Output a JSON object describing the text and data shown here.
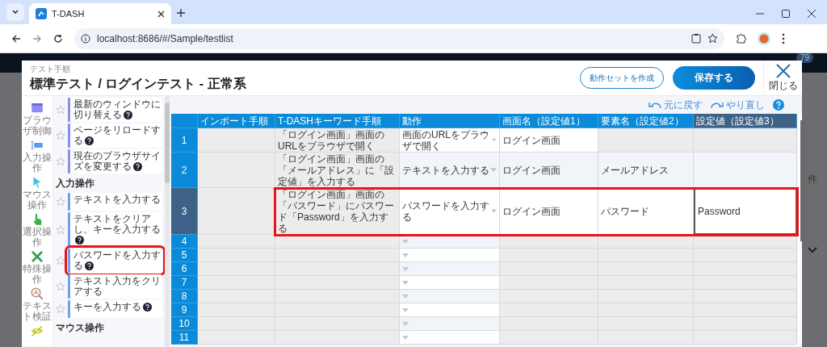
{
  "browser": {
    "tab_title": "T-DASH",
    "url": "localhost:8686/#/Sample/testlist"
  },
  "background_page": {
    "badge": "79",
    "text_fragment": "件"
  },
  "modal": {
    "breadcrumb": "テスト手順",
    "title": "標準テスト / ログインテスト - 正常系",
    "close_label": "閉じる",
    "buttons": [
      {
        "label": "動作セットを作成",
        "kind": "outline"
      },
      {
        "label": "保存する",
        "kind": "primary"
      }
    ]
  },
  "categories": [
    {
      "kind": "browser",
      "label": "ブラウザ制御"
    },
    {
      "kind": "input",
      "label": "入力操作"
    },
    {
      "kind": "mouse",
      "label": "マウス操作"
    },
    {
      "kind": "select",
      "label": "選択操作"
    },
    {
      "kind": "special",
      "label": "特殊操作"
    },
    {
      "kind": "verify",
      "label": "テキスト検証"
    },
    {
      "kind": "hide"
    }
  ],
  "actions": [
    {
      "kind": "item",
      "label": "最新のウィンドウに切り替える",
      "help": true,
      "starred": false,
      "color": "#8c8cf2",
      "highlighted": false
    },
    {
      "kind": "item",
      "label": "ページをリロードする",
      "help": true,
      "starred": false,
      "color": "#8c8cf2",
      "highlighted": false
    },
    {
      "kind": "item",
      "label": "現在のブラウザサイズを変更する",
      "help": true,
      "starred": false,
      "color": "#8c8cf2",
      "highlighted": false
    },
    {
      "kind": "heading",
      "label": "入力操作"
    },
    {
      "kind": "item",
      "label": "テキストを入力する",
      "help": false,
      "starred": false,
      "color": "#6f9ff0",
      "highlighted": false
    },
    {
      "kind": "item",
      "label": "テキストをクリアし、キーを入力する",
      "help": true,
      "starred": false,
      "color": "#6f9ff0",
      "highlighted": false
    },
    {
      "kind": "item",
      "label": "パスワードを入力する",
      "help": true,
      "starred": false,
      "color": "#6f9ff0",
      "highlighted": true
    },
    {
      "kind": "item",
      "label": "テキスト入力をクリアする",
      "help": false,
      "starred": false,
      "color": "#6f9ff0",
      "highlighted": false
    },
    {
      "kind": "item",
      "label": "キーを入力する",
      "help": true,
      "starred": false,
      "color": "#6f9ff0",
      "highlighted": false
    },
    {
      "kind": "heading",
      "label": "マウス操作"
    }
  ],
  "toolbar": {
    "undo": "元に戻す",
    "redo": "やり直し"
  },
  "grid": {
    "columns": [
      {
        "label": "インポート手順",
        "selected": false
      },
      {
        "label": "T-DASHキーワード手順",
        "selected": false
      },
      {
        "label": "動作",
        "selected": false
      },
      {
        "label": "画面名（設定値1）",
        "selected": false
      },
      {
        "label": "要素名（設定値2）",
        "selected": false
      },
      {
        "label": "設定値（設定値3）",
        "selected": true
      }
    ],
    "rows": [
      {
        "number": "1",
        "selected": false,
        "highlighted": false,
        "keyword": "「ログイン画面」画面のURLをブラウザで開く",
        "action": "画面のURLをブラウザで開く",
        "screen": "ログイン画面"
      },
      {
        "number": "2",
        "selected": false,
        "highlighted": false,
        "keyword": "「ログイン画面」画面の「メールアドレス」に「設定値」を入力する",
        "action": "テキストを入力する",
        "screen": "ログイン画面",
        "element": "メールアドレス"
      },
      {
        "number": "3",
        "selected": true,
        "highlighted": true,
        "keyword": "「ログイン画面」画面の「パスワード」にパスワード「Password」を入力する",
        "action": "パスワードを入力する",
        "screen": "ログイン画面",
        "element": "パスワード",
        "value": "Password"
      },
      {
        "number": "4",
        "selected": false,
        "highlighted": false
      },
      {
        "number": "5",
        "selected": false,
        "highlighted": false
      },
      {
        "number": "6",
        "selected": false,
        "highlighted": false
      },
      {
        "number": "7",
        "selected": false,
        "highlighted": false
      },
      {
        "number": "8",
        "selected": false,
        "highlighted": false
      },
      {
        "number": "9",
        "selected": false,
        "highlighted": false
      },
      {
        "number": "10",
        "selected": false,
        "highlighted": false
      },
      {
        "number": "11",
        "selected": false,
        "highlighted": false
      }
    ]
  }
}
